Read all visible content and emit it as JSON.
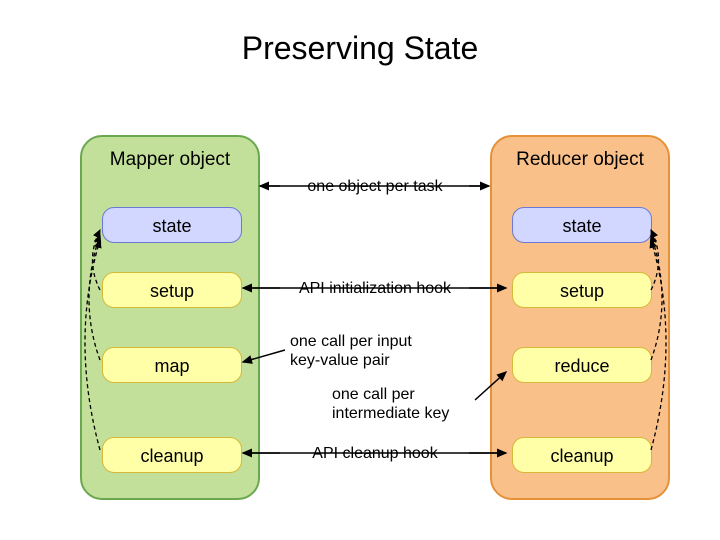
{
  "title": "Preserving State",
  "mapper": {
    "title": "Mapper object",
    "state": "state",
    "setup": "setup",
    "map": "map",
    "cleanup": "cleanup"
  },
  "reducer": {
    "title": "Reducer object",
    "state": "state",
    "setup": "setup",
    "reduce": "reduce",
    "cleanup": "cleanup"
  },
  "labels": {
    "per_task": "one object per task",
    "init_hook": "API initialization hook",
    "per_input": "one call per input key-value pair",
    "per_intermediate": "one call per intermediate key",
    "cleanup_hook": "API cleanup hook"
  }
}
